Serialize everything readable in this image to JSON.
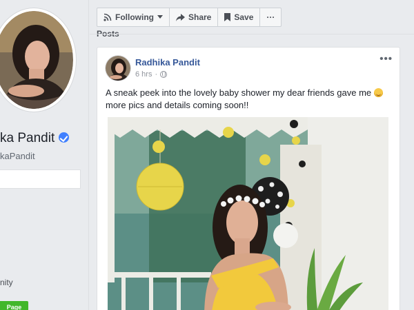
{
  "toolbar": {
    "following_label": "Following",
    "share_label": "Share",
    "save_label": "Save",
    "more_label": "···",
    "icons": [
      "rss-icon",
      "chevron-down-icon",
      "share-arrow-icon",
      "bookmark-icon"
    ]
  },
  "profile": {
    "name_visible": "ka Pandit",
    "handle_visible": "kaPandit",
    "about_partial": "nity",
    "badge_label": "Page",
    "verified": true
  },
  "posts": {
    "heading": "Posts",
    "items": [
      {
        "author": "Radhika Pandit",
        "time": "6 hrs",
        "privacy_separator": "·",
        "text": "A sneak peek into the lovely baby shower my dear friends gave me",
        "text_line2": "more pics and details coming soon!!",
        "menu": "•••"
      }
    ]
  },
  "colors": {
    "page_bg": "#e9ebee",
    "link_blue": "#365899",
    "verified_blue": "#4080ff",
    "badge_green": "#42b72a"
  }
}
